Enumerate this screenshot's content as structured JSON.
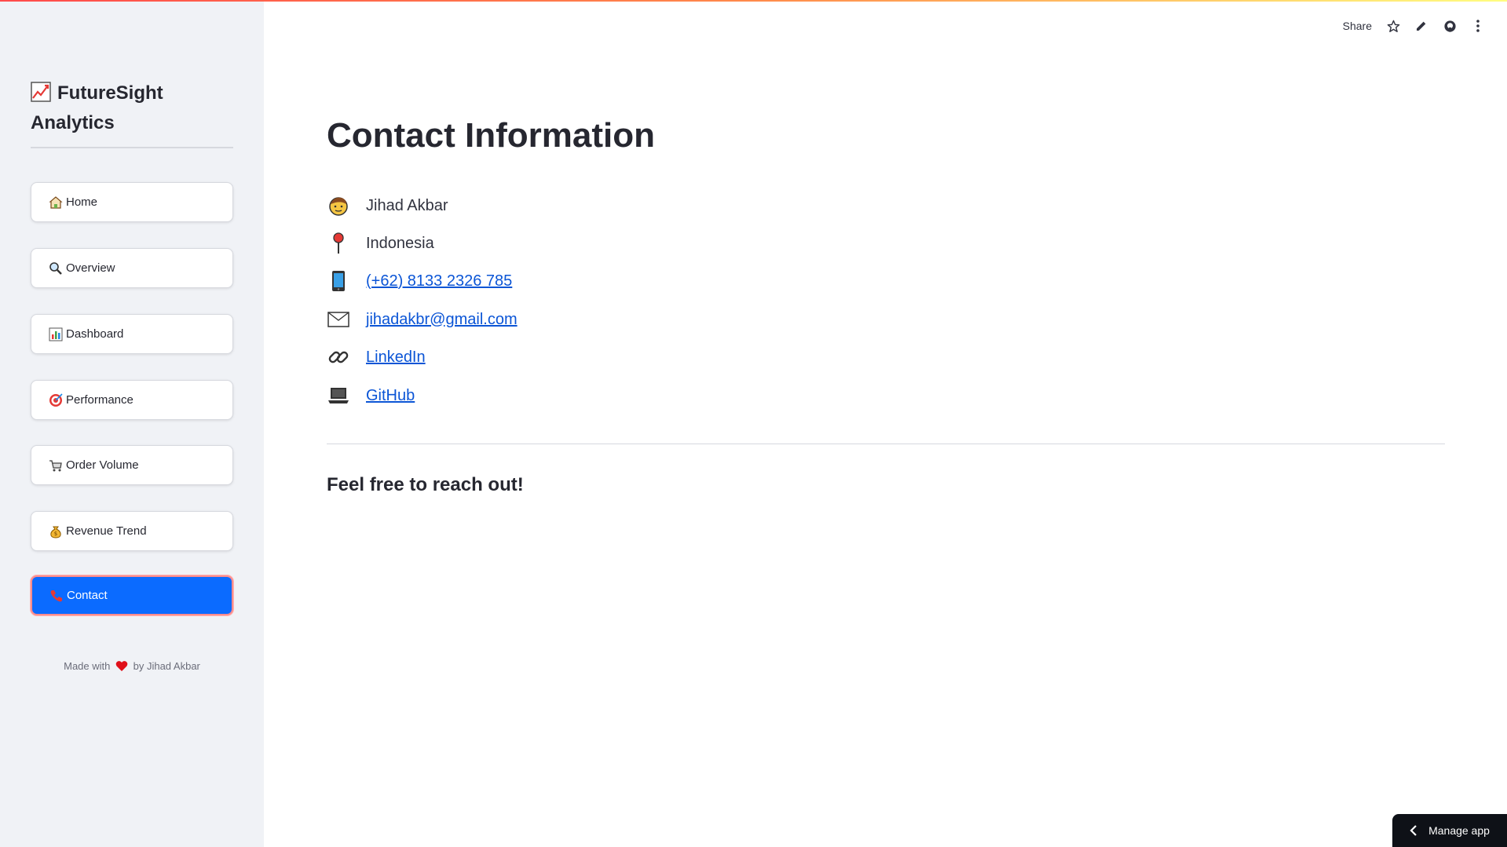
{
  "app": {
    "brand_title": "FutureSight Analytics",
    "brand_icon": "chart-increasing-icon"
  },
  "toolbar": {
    "share_label": "Share",
    "icons": [
      "star-icon",
      "pencil-icon",
      "github-icon",
      "more-vertical-icon"
    ]
  },
  "sidebar": {
    "items": [
      {
        "label": "Home",
        "icon": "house-icon",
        "active": false
      },
      {
        "label": "Overview",
        "icon": "magnifier-icon",
        "active": false
      },
      {
        "label": "Dashboard",
        "icon": "bar-chart-icon",
        "active": false
      },
      {
        "label": "Performance",
        "icon": "target-icon",
        "active": false
      },
      {
        "label": "Order Volume",
        "icon": "shopping-cart-icon",
        "active": false
      },
      {
        "label": "Revenue Trend",
        "icon": "money-bag-icon",
        "active": false
      },
      {
        "label": "Contact",
        "icon": "telephone-icon",
        "active": true
      }
    ],
    "footer_prefix": "Made with",
    "footer_suffix": "by Jihad Akbar"
  },
  "main": {
    "title": "Contact Information",
    "contacts": [
      {
        "icon": "person-face-icon",
        "text": "Jihad Akbar",
        "link": false
      },
      {
        "icon": "pin-icon",
        "text": "Indonesia",
        "link": false
      },
      {
        "icon": "mobile-phone-icon",
        "text": "(+62) 8133 2326 785",
        "link": true
      },
      {
        "icon": "envelope-icon",
        "text": "jihadakbr@gmail.com",
        "link": true
      },
      {
        "icon": "link-icon",
        "text": "LinkedIn",
        "link": true
      },
      {
        "icon": "laptop-icon",
        "text": "GitHub",
        "link": true
      }
    ],
    "closing": "Feel free to reach out!"
  },
  "manage_app": {
    "label": "Manage app"
  },
  "colors": {
    "accent": "#0b6bff",
    "link": "#0b55d6",
    "sidebar_bg": "#f0f2f6",
    "manage_bg": "#0e1117"
  }
}
